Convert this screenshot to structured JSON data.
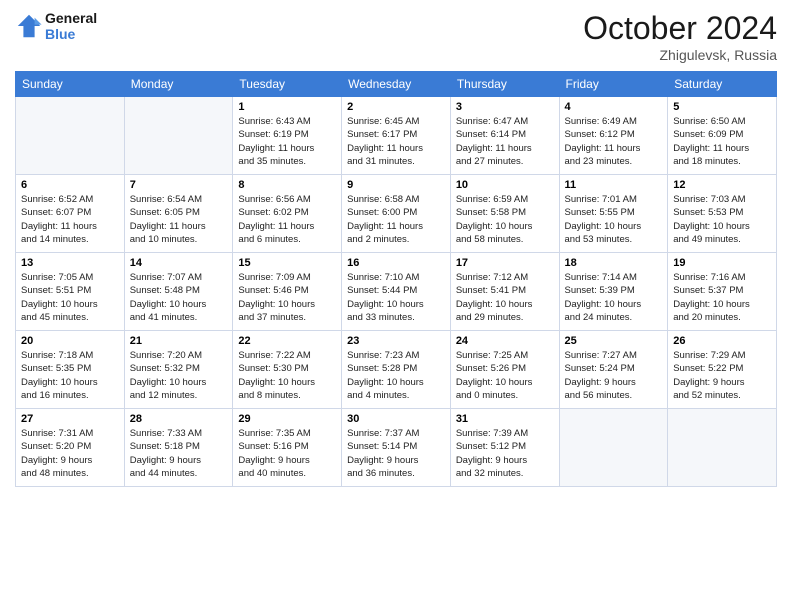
{
  "logo": {
    "line1": "General",
    "line2": "Blue"
  },
  "title": "October 2024",
  "location": "Zhigulevsk, Russia",
  "days_header": [
    "Sunday",
    "Monday",
    "Tuesday",
    "Wednesday",
    "Thursday",
    "Friday",
    "Saturday"
  ],
  "weeks": [
    [
      {
        "num": "",
        "info": ""
      },
      {
        "num": "",
        "info": ""
      },
      {
        "num": "1",
        "info": "Sunrise: 6:43 AM\nSunset: 6:19 PM\nDaylight: 11 hours\nand 35 minutes."
      },
      {
        "num": "2",
        "info": "Sunrise: 6:45 AM\nSunset: 6:17 PM\nDaylight: 11 hours\nand 31 minutes."
      },
      {
        "num": "3",
        "info": "Sunrise: 6:47 AM\nSunset: 6:14 PM\nDaylight: 11 hours\nand 27 minutes."
      },
      {
        "num": "4",
        "info": "Sunrise: 6:49 AM\nSunset: 6:12 PM\nDaylight: 11 hours\nand 23 minutes."
      },
      {
        "num": "5",
        "info": "Sunrise: 6:50 AM\nSunset: 6:09 PM\nDaylight: 11 hours\nand 18 minutes."
      }
    ],
    [
      {
        "num": "6",
        "info": "Sunrise: 6:52 AM\nSunset: 6:07 PM\nDaylight: 11 hours\nand 14 minutes."
      },
      {
        "num": "7",
        "info": "Sunrise: 6:54 AM\nSunset: 6:05 PM\nDaylight: 11 hours\nand 10 minutes."
      },
      {
        "num": "8",
        "info": "Sunrise: 6:56 AM\nSunset: 6:02 PM\nDaylight: 11 hours\nand 6 minutes."
      },
      {
        "num": "9",
        "info": "Sunrise: 6:58 AM\nSunset: 6:00 PM\nDaylight: 11 hours\nand 2 minutes."
      },
      {
        "num": "10",
        "info": "Sunrise: 6:59 AM\nSunset: 5:58 PM\nDaylight: 10 hours\nand 58 minutes."
      },
      {
        "num": "11",
        "info": "Sunrise: 7:01 AM\nSunset: 5:55 PM\nDaylight: 10 hours\nand 53 minutes."
      },
      {
        "num": "12",
        "info": "Sunrise: 7:03 AM\nSunset: 5:53 PM\nDaylight: 10 hours\nand 49 minutes."
      }
    ],
    [
      {
        "num": "13",
        "info": "Sunrise: 7:05 AM\nSunset: 5:51 PM\nDaylight: 10 hours\nand 45 minutes."
      },
      {
        "num": "14",
        "info": "Sunrise: 7:07 AM\nSunset: 5:48 PM\nDaylight: 10 hours\nand 41 minutes."
      },
      {
        "num": "15",
        "info": "Sunrise: 7:09 AM\nSunset: 5:46 PM\nDaylight: 10 hours\nand 37 minutes."
      },
      {
        "num": "16",
        "info": "Sunrise: 7:10 AM\nSunset: 5:44 PM\nDaylight: 10 hours\nand 33 minutes."
      },
      {
        "num": "17",
        "info": "Sunrise: 7:12 AM\nSunset: 5:41 PM\nDaylight: 10 hours\nand 29 minutes."
      },
      {
        "num": "18",
        "info": "Sunrise: 7:14 AM\nSunset: 5:39 PM\nDaylight: 10 hours\nand 24 minutes."
      },
      {
        "num": "19",
        "info": "Sunrise: 7:16 AM\nSunset: 5:37 PM\nDaylight: 10 hours\nand 20 minutes."
      }
    ],
    [
      {
        "num": "20",
        "info": "Sunrise: 7:18 AM\nSunset: 5:35 PM\nDaylight: 10 hours\nand 16 minutes."
      },
      {
        "num": "21",
        "info": "Sunrise: 7:20 AM\nSunset: 5:32 PM\nDaylight: 10 hours\nand 12 minutes."
      },
      {
        "num": "22",
        "info": "Sunrise: 7:22 AM\nSunset: 5:30 PM\nDaylight: 10 hours\nand 8 minutes."
      },
      {
        "num": "23",
        "info": "Sunrise: 7:23 AM\nSunset: 5:28 PM\nDaylight: 10 hours\nand 4 minutes."
      },
      {
        "num": "24",
        "info": "Sunrise: 7:25 AM\nSunset: 5:26 PM\nDaylight: 10 hours\nand 0 minutes."
      },
      {
        "num": "25",
        "info": "Sunrise: 7:27 AM\nSunset: 5:24 PM\nDaylight: 9 hours\nand 56 minutes."
      },
      {
        "num": "26",
        "info": "Sunrise: 7:29 AM\nSunset: 5:22 PM\nDaylight: 9 hours\nand 52 minutes."
      }
    ],
    [
      {
        "num": "27",
        "info": "Sunrise: 7:31 AM\nSunset: 5:20 PM\nDaylight: 9 hours\nand 48 minutes."
      },
      {
        "num": "28",
        "info": "Sunrise: 7:33 AM\nSunset: 5:18 PM\nDaylight: 9 hours\nand 44 minutes."
      },
      {
        "num": "29",
        "info": "Sunrise: 7:35 AM\nSunset: 5:16 PM\nDaylight: 9 hours\nand 40 minutes."
      },
      {
        "num": "30",
        "info": "Sunrise: 7:37 AM\nSunset: 5:14 PM\nDaylight: 9 hours\nand 36 minutes."
      },
      {
        "num": "31",
        "info": "Sunrise: 7:39 AM\nSunset: 5:12 PM\nDaylight: 9 hours\nand 32 minutes."
      },
      {
        "num": "",
        "info": ""
      },
      {
        "num": "",
        "info": ""
      }
    ]
  ]
}
